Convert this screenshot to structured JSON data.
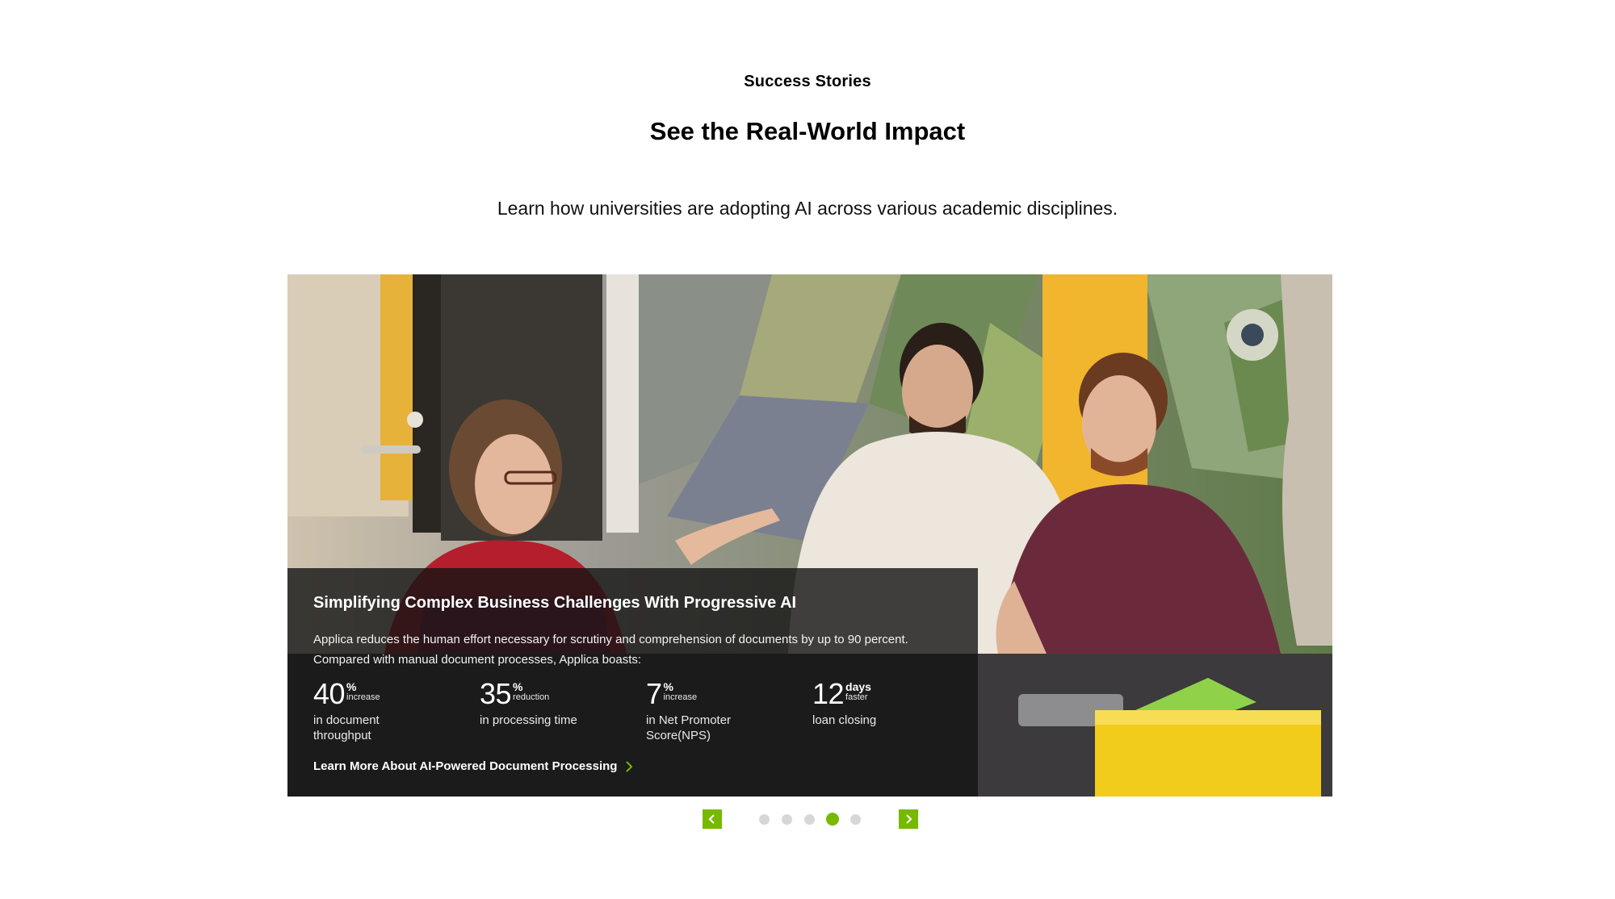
{
  "section": {
    "eyebrow": "Success Stories",
    "headline": "See the Real-World Impact",
    "subhead": "Learn how universities are adopting AI across various academic disciplines."
  },
  "card": {
    "title": "Simplifying Complex Business Challenges With Progressive AI",
    "description_line1": "Applica reduces the human effort necessary for scrutiny and comprehension of documents by up to 90 percent.",
    "description_line2": "Compared with manual document processes, Applica boasts:",
    "stats": [
      {
        "value": "40",
        "unit": "%",
        "qualifier": "increase",
        "caption": "in document throughput"
      },
      {
        "value": "35",
        "unit": "%",
        "qualifier": "reduction",
        "caption": "in processing time"
      },
      {
        "value": "7",
        "unit": "%",
        "qualifier": "increase",
        "caption": "in Net Promoter Score(NPS)"
      },
      {
        "value": "12",
        "unit": "days",
        "qualifier": "faster",
        "caption": "loan closing"
      }
    ],
    "cta_label": "Learn More About AI-Powered Document Processing",
    "image_alt": "Three researchers collaborating at a table with robotics parts"
  },
  "carousel": {
    "prev_icon": "chevron-left-icon",
    "next_icon": "chevron-right-icon",
    "slide_count": 5,
    "active_slide": 4,
    "accent_color": "#76b900",
    "inactive_dot_color": "#d7d7d7"
  }
}
